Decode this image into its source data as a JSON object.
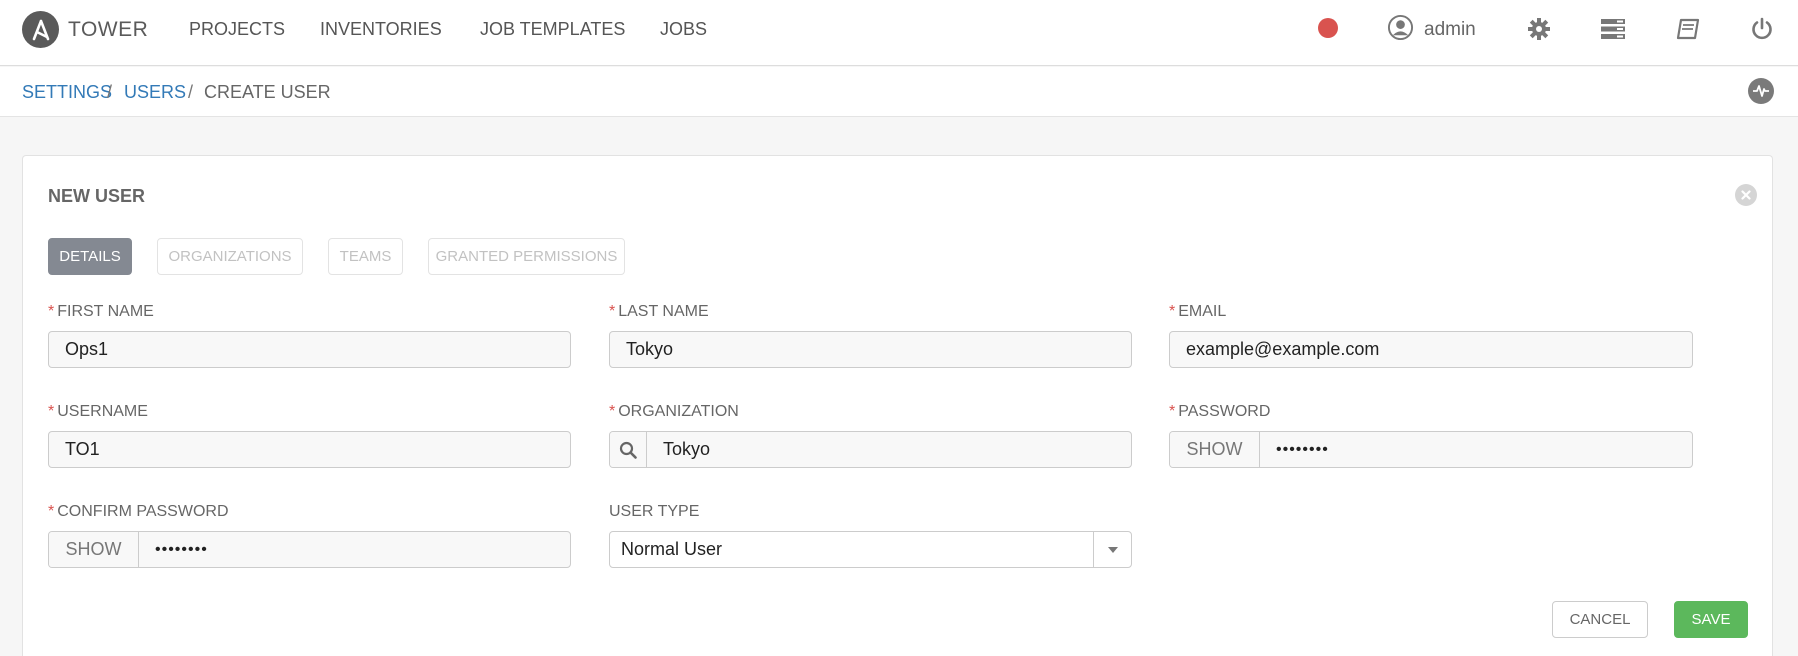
{
  "app": {
    "brand": "TOWER"
  },
  "nav": {
    "links": [
      "PROJECTS",
      "INVENTORIES",
      "JOB TEMPLATES",
      "JOBS"
    ],
    "user": "admin",
    "status_color": "#d9534f"
  },
  "breadcrumb": {
    "settings": "SETTINGS",
    "users": "USERS",
    "current": "CREATE USER",
    "sep": "/"
  },
  "form": {
    "title": "NEW USER",
    "tabs": [
      "DETAILS",
      "ORGANIZATIONS",
      "TEAMS",
      "GRANTED PERMISSIONS"
    ],
    "required_mark": "*",
    "fields": {
      "first_name": {
        "label": "FIRST NAME",
        "value": "Ops1"
      },
      "last_name": {
        "label": "LAST NAME",
        "value": "Tokyo"
      },
      "email": {
        "label": "EMAIL",
        "value": "example@example.com"
      },
      "username": {
        "label": "USERNAME",
        "value": "TO1"
      },
      "organization": {
        "label": "ORGANIZATION",
        "value": "Tokyo"
      },
      "password": {
        "label": "PASSWORD",
        "show": "SHOW",
        "masked": "••••••••"
      },
      "confirm_password": {
        "label": "CONFIRM PASSWORD",
        "show": "SHOW",
        "masked": "••••••••"
      },
      "user_type": {
        "label": "USER TYPE",
        "value": "Normal User"
      }
    },
    "buttons": {
      "cancel": "CANCEL",
      "save": "SAVE"
    }
  },
  "colors": {
    "accent_link": "#337ab7",
    "save": "#5cb85c",
    "active_tab": "#848992",
    "required": "#d9534f"
  }
}
